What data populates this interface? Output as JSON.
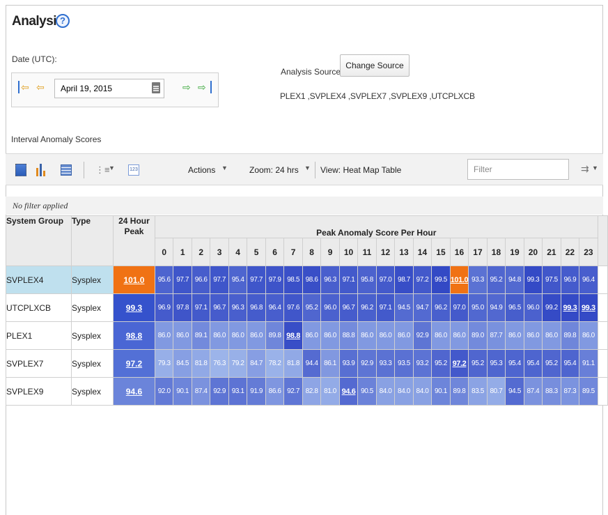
{
  "page": {
    "title": "Analysis",
    "help_glyph": "?"
  },
  "date": {
    "label": "Date (UTC):",
    "value": "April 19, 2015"
  },
  "source": {
    "label": "Analysis Source:",
    "button_label": "Change Source",
    "list": "PLEX1 ,SVPLEX4 ,SVPLEX7 ,SVPLEX9 ,UTCPLXCB"
  },
  "interval_label": "Interval Anomaly Scores",
  "toolbar": {
    "list_icon_glyph": "⋮≡",
    "num_icon_text": "123",
    "caret": "▼",
    "actions": "Actions",
    "zoom": "Zoom: 24 hrs",
    "view": "View: Heat Map Table",
    "filter_placeholder": "Filter",
    "export_glyph": "⇉"
  },
  "filter_status": "No filter applied",
  "table": {
    "col_group": "System Group",
    "col_type": "Type",
    "col_peak": "24 Hour Peak",
    "col_hours": "Peak Anomaly Score Per Hour",
    "hours": [
      "0",
      "1",
      "2",
      "3",
      "4",
      "5",
      "6",
      "7",
      "8",
      "9",
      "10",
      "11",
      "12",
      "13",
      "14",
      "15",
      "16",
      "17",
      "18",
      "19",
      "20",
      "21",
      "22",
      "23"
    ],
    "rows": [
      {
        "name": "SVPLEX4",
        "type": "Sysplex",
        "peak": "101.0",
        "peak_color": "#f07214",
        "selected": true,
        "values": [
          "95.6",
          "97.7",
          "96.6",
          "97.7",
          "95.4",
          "97.7",
          "97.9",
          "98.5",
          "98.6",
          "96.3",
          "97.1",
          "95.8",
          "97.0",
          "98.7",
          "97.2",
          "99.5",
          "101.0",
          "93.3",
          "95.2",
          "94.8",
          "99.3",
          "97.5",
          "96.9",
          "96.4"
        ],
        "bold": [
          16
        ]
      },
      {
        "name": "UTCPLXCB",
        "type": "Sysplex",
        "peak": "99.3",
        "peak_color": "#3552cc",
        "selected": false,
        "values": [
          "96.9",
          "97.8",
          "97.1",
          "96.7",
          "96.3",
          "96.8",
          "96.4",
          "97.6",
          "95.2",
          "96.0",
          "96.7",
          "96.2",
          "97.1",
          "94.5",
          "94.7",
          "96.2",
          "97.0",
          "95.0",
          "94.9",
          "96.5",
          "96.0",
          "99.2",
          "99.3",
          "99.3"
        ],
        "bold": [
          22,
          23
        ]
      },
      {
        "name": "PLEX1",
        "type": "Sysplex",
        "peak": "98.8",
        "peak_color": "#4a66d4",
        "selected": false,
        "values": [
          "86.0",
          "86.0",
          "89.1",
          "86.0",
          "86.0",
          "86.0",
          "89.8",
          "98.8",
          "86.0",
          "86.0",
          "88.8",
          "86.0",
          "86.0",
          "86.0",
          "92.9",
          "86.0",
          "86.0",
          "89.0",
          "87.7",
          "86.0",
          "86.0",
          "86.0",
          "89.8",
          "86.0"
        ],
        "bold": [
          7
        ]
      },
      {
        "name": "SVPLEX7",
        "type": "Sysplex",
        "peak": "97.2",
        "peak_color": "#5370d6",
        "selected": false,
        "values": [
          "79.3",
          "84.5",
          "81.8",
          "76.3",
          "79.2",
          "84.7",
          "78.2",
          "81.8",
          "94.4",
          "86.1",
          "93.9",
          "92.9",
          "93.3",
          "93.5",
          "93.2",
          "95.2",
          "97.2",
          "95.2",
          "95.3",
          "95.4",
          "95.4",
          "95.2",
          "95.4",
          "91.1"
        ],
        "bold": [
          16
        ]
      },
      {
        "name": "SVPLEX9",
        "type": "Sysplex",
        "peak": "94.6",
        "peak_color": "#6b84da",
        "selected": false,
        "values": [
          "92.0",
          "90.1",
          "87.4",
          "92.9",
          "93.1",
          "91.9",
          "86.6",
          "92.7",
          "82.8",
          "81.0",
          "94.6",
          "90.5",
          "84.0",
          "84.0",
          "84.0",
          "90.1",
          "89.8",
          "83.5",
          "80.7",
          "94.5",
          "87.4",
          "88.3",
          "87.3",
          "89.5"
        ],
        "bold": [
          10
        ]
      }
    ]
  },
  "colors": {
    "orange": "#f07214",
    "blue_dark": "#2f45c4",
    "blue_light": "#9cb4ea"
  }
}
